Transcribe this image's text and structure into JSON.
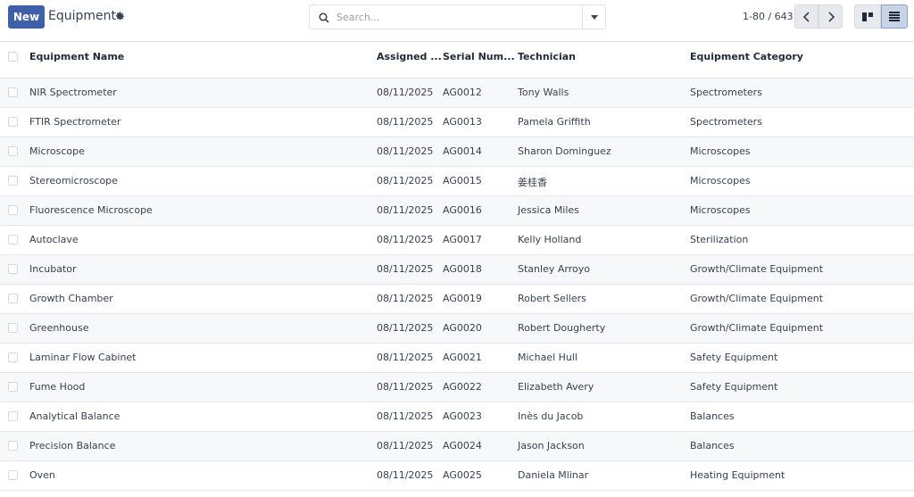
{
  "control_panel": {
    "new_label": "New",
    "title": "Equipment",
    "search_placeholder": "Search...",
    "pager": "1-80 / 643"
  },
  "colors": {
    "primary": "#3f5fa8",
    "row_alt": "#f7f8fa",
    "border": "#dee2e6"
  },
  "icons": [
    "gear-icon",
    "search-icon",
    "caret-down-icon",
    "chevron-left-icon",
    "chevron-right-icon",
    "kanban-view-icon",
    "list-view-icon"
  ],
  "table": {
    "columns": [
      "Equipment Name",
      "Assigned ...",
      "Serial Num...",
      "Technician",
      "Equipment Category"
    ],
    "rows": [
      [
        "NIR Spectrometer",
        "08/11/2025",
        "AG0012",
        "Tony Walls",
        "Spectrometers"
      ],
      [
        "FTIR Spectrometer",
        "08/11/2025",
        "AG0013",
        "Pamela Griffith",
        "Spectrometers"
      ],
      [
        "Microscope",
        "08/11/2025",
        "AG0014",
        "Sharon Dominguez",
        "Microscopes"
      ],
      [
        "Stereomicroscope",
        "08/11/2025",
        "AG0015",
        "姜桂香",
        "Microscopes"
      ],
      [
        "Fluorescence Microscope",
        "08/11/2025",
        "AG0016",
        "Jessica Miles",
        "Microscopes"
      ],
      [
        "Autoclave",
        "08/11/2025",
        "AG0017",
        "Kelly Holland",
        "Sterilization"
      ],
      [
        "Incubator",
        "08/11/2025",
        "AG0018",
        "Stanley Arroyo",
        "Growth/Climate Equipment"
      ],
      [
        "Growth Chamber",
        "08/11/2025",
        "AG0019",
        "Robert Sellers",
        "Growth/Climate Equipment"
      ],
      [
        "Greenhouse",
        "08/11/2025",
        "AG0020",
        "Robert Dougherty",
        "Growth/Climate Equipment"
      ],
      [
        "Laminar Flow Cabinet",
        "08/11/2025",
        "AG0021",
        "Michael Hull",
        "Safety Equipment"
      ],
      [
        "Fume Hood",
        "08/11/2025",
        "AG0022",
        "Elizabeth Avery",
        "Safety Equipment"
      ],
      [
        "Analytical Balance",
        "08/11/2025",
        "AG0023",
        "Inès du Jacob",
        "Balances"
      ],
      [
        "Precision Balance",
        "08/11/2025",
        "AG0024",
        "Jason Jackson",
        "Balances"
      ],
      [
        "Oven",
        "08/11/2025",
        "AG0025",
        "Daniela Mlinar",
        "Heating Equipment"
      ]
    ]
  }
}
